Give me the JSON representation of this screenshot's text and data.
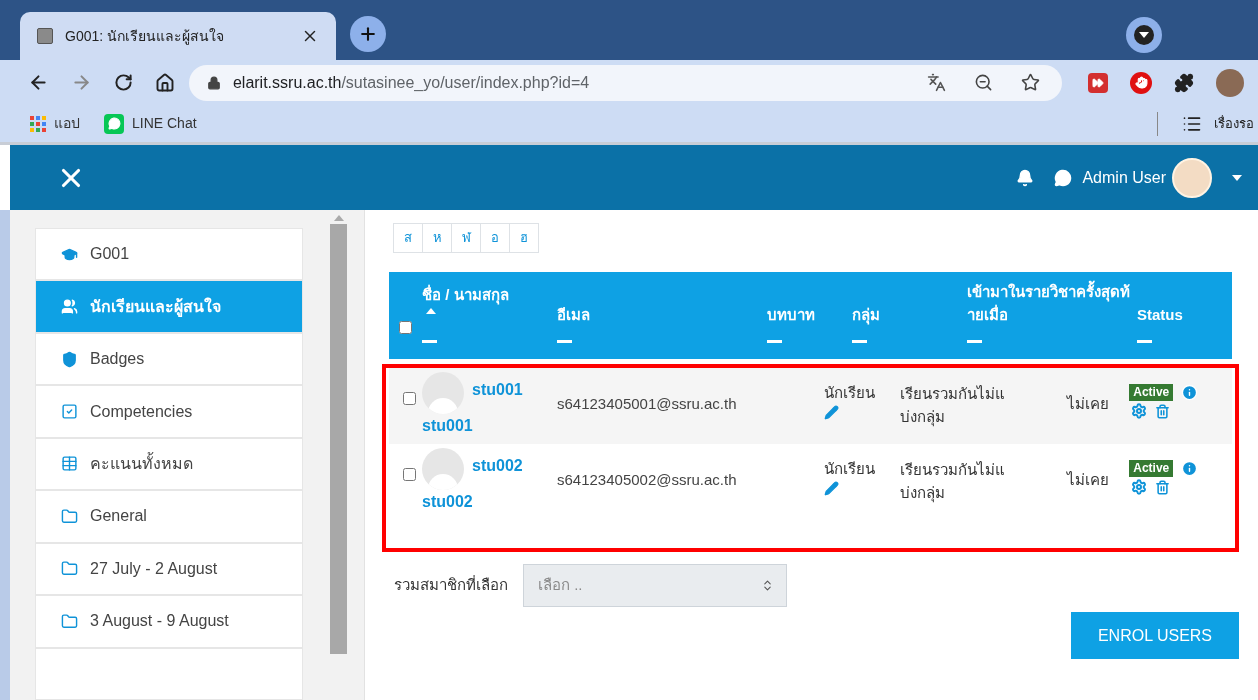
{
  "browser": {
    "tab": {
      "title": "G001: นักเรียนและผู้สนใจ"
    },
    "address": {
      "host": "elarit.ssru.ac.th",
      "path": "/sutasinee_yo/user/index.php?id=4"
    },
    "bookmarks": [
      {
        "kind": "apps",
        "label": "แอป"
      },
      {
        "kind": "line",
        "label": "LINE Chat"
      }
    ],
    "reading_list": {
      "label": "เรื่องรอ"
    }
  },
  "navbar": {
    "user_name": "Admin User"
  },
  "sidebar": {
    "items": [
      {
        "kind": "course",
        "label": "G001",
        "selected": false
      },
      {
        "kind": "participants",
        "label": "นักเรียนและผู้สนใจ",
        "selected": true
      },
      {
        "kind": "badges",
        "label": "Badges",
        "selected": false
      },
      {
        "kind": "competencies",
        "label": "Competencies",
        "selected": false
      },
      {
        "kind": "grades",
        "label": "คะแนนทั้งหมด",
        "selected": false
      },
      {
        "kind": "section",
        "label": "General",
        "selected": false
      },
      {
        "kind": "section",
        "label": "27 July - 2 August",
        "selected": false
      },
      {
        "kind": "section",
        "label": "3 August - 9 August",
        "selected": false
      }
    ]
  },
  "letter_filter": [
    {
      "label": "ส",
      "selected": false
    },
    {
      "label": "ห",
      "selected": false
    },
    {
      "label": "ฬ",
      "selected": false
    },
    {
      "label": "อ",
      "selected": false
    },
    {
      "label": "ฮ",
      "selected": false
    }
  ],
  "table": {
    "select_all": {
      "checked": false
    },
    "columns": [
      {
        "label": "ชื่อ / นามสกุล",
        "sorted": true
      },
      {
        "label": "อีเมล",
        "sorted": false
      },
      {
        "label": "บทบาท",
        "sorted": false
      },
      {
        "label": "กลุ่ม",
        "sorted": false
      },
      {
        "label": "เข้ามาในรายวิชาครั้งสุดท้ายเมื่อ",
        "sorted": false
      },
      {
        "label": "Status",
        "sorted": false
      }
    ],
    "rows": [
      {
        "checked": false,
        "first_name": "stu001",
        "last_name": "stu001",
        "email": "s64123405001@ssru.ac.th",
        "role": "นักเรียน",
        "group": "เรียนรวมกันไม่แบ่งกลุ่ม",
        "last_access": "ไม่เคย",
        "status": "Active"
      },
      {
        "checked": false,
        "first_name": "stu002",
        "last_name": "stu002",
        "email": "s64123405002@ssru.ac.th",
        "role": "นักเรียน",
        "group": "เรียนรวมกันไม่แบ่งกลุ่ม",
        "last_access": "ไม่เคย",
        "status": "Active"
      }
    ]
  },
  "bulk_action": {
    "label": "รวมสมาชิกที่เลือก",
    "placeholder": "เลือก .."
  },
  "enrol_button": {
    "label": "ENROL USERS"
  }
}
